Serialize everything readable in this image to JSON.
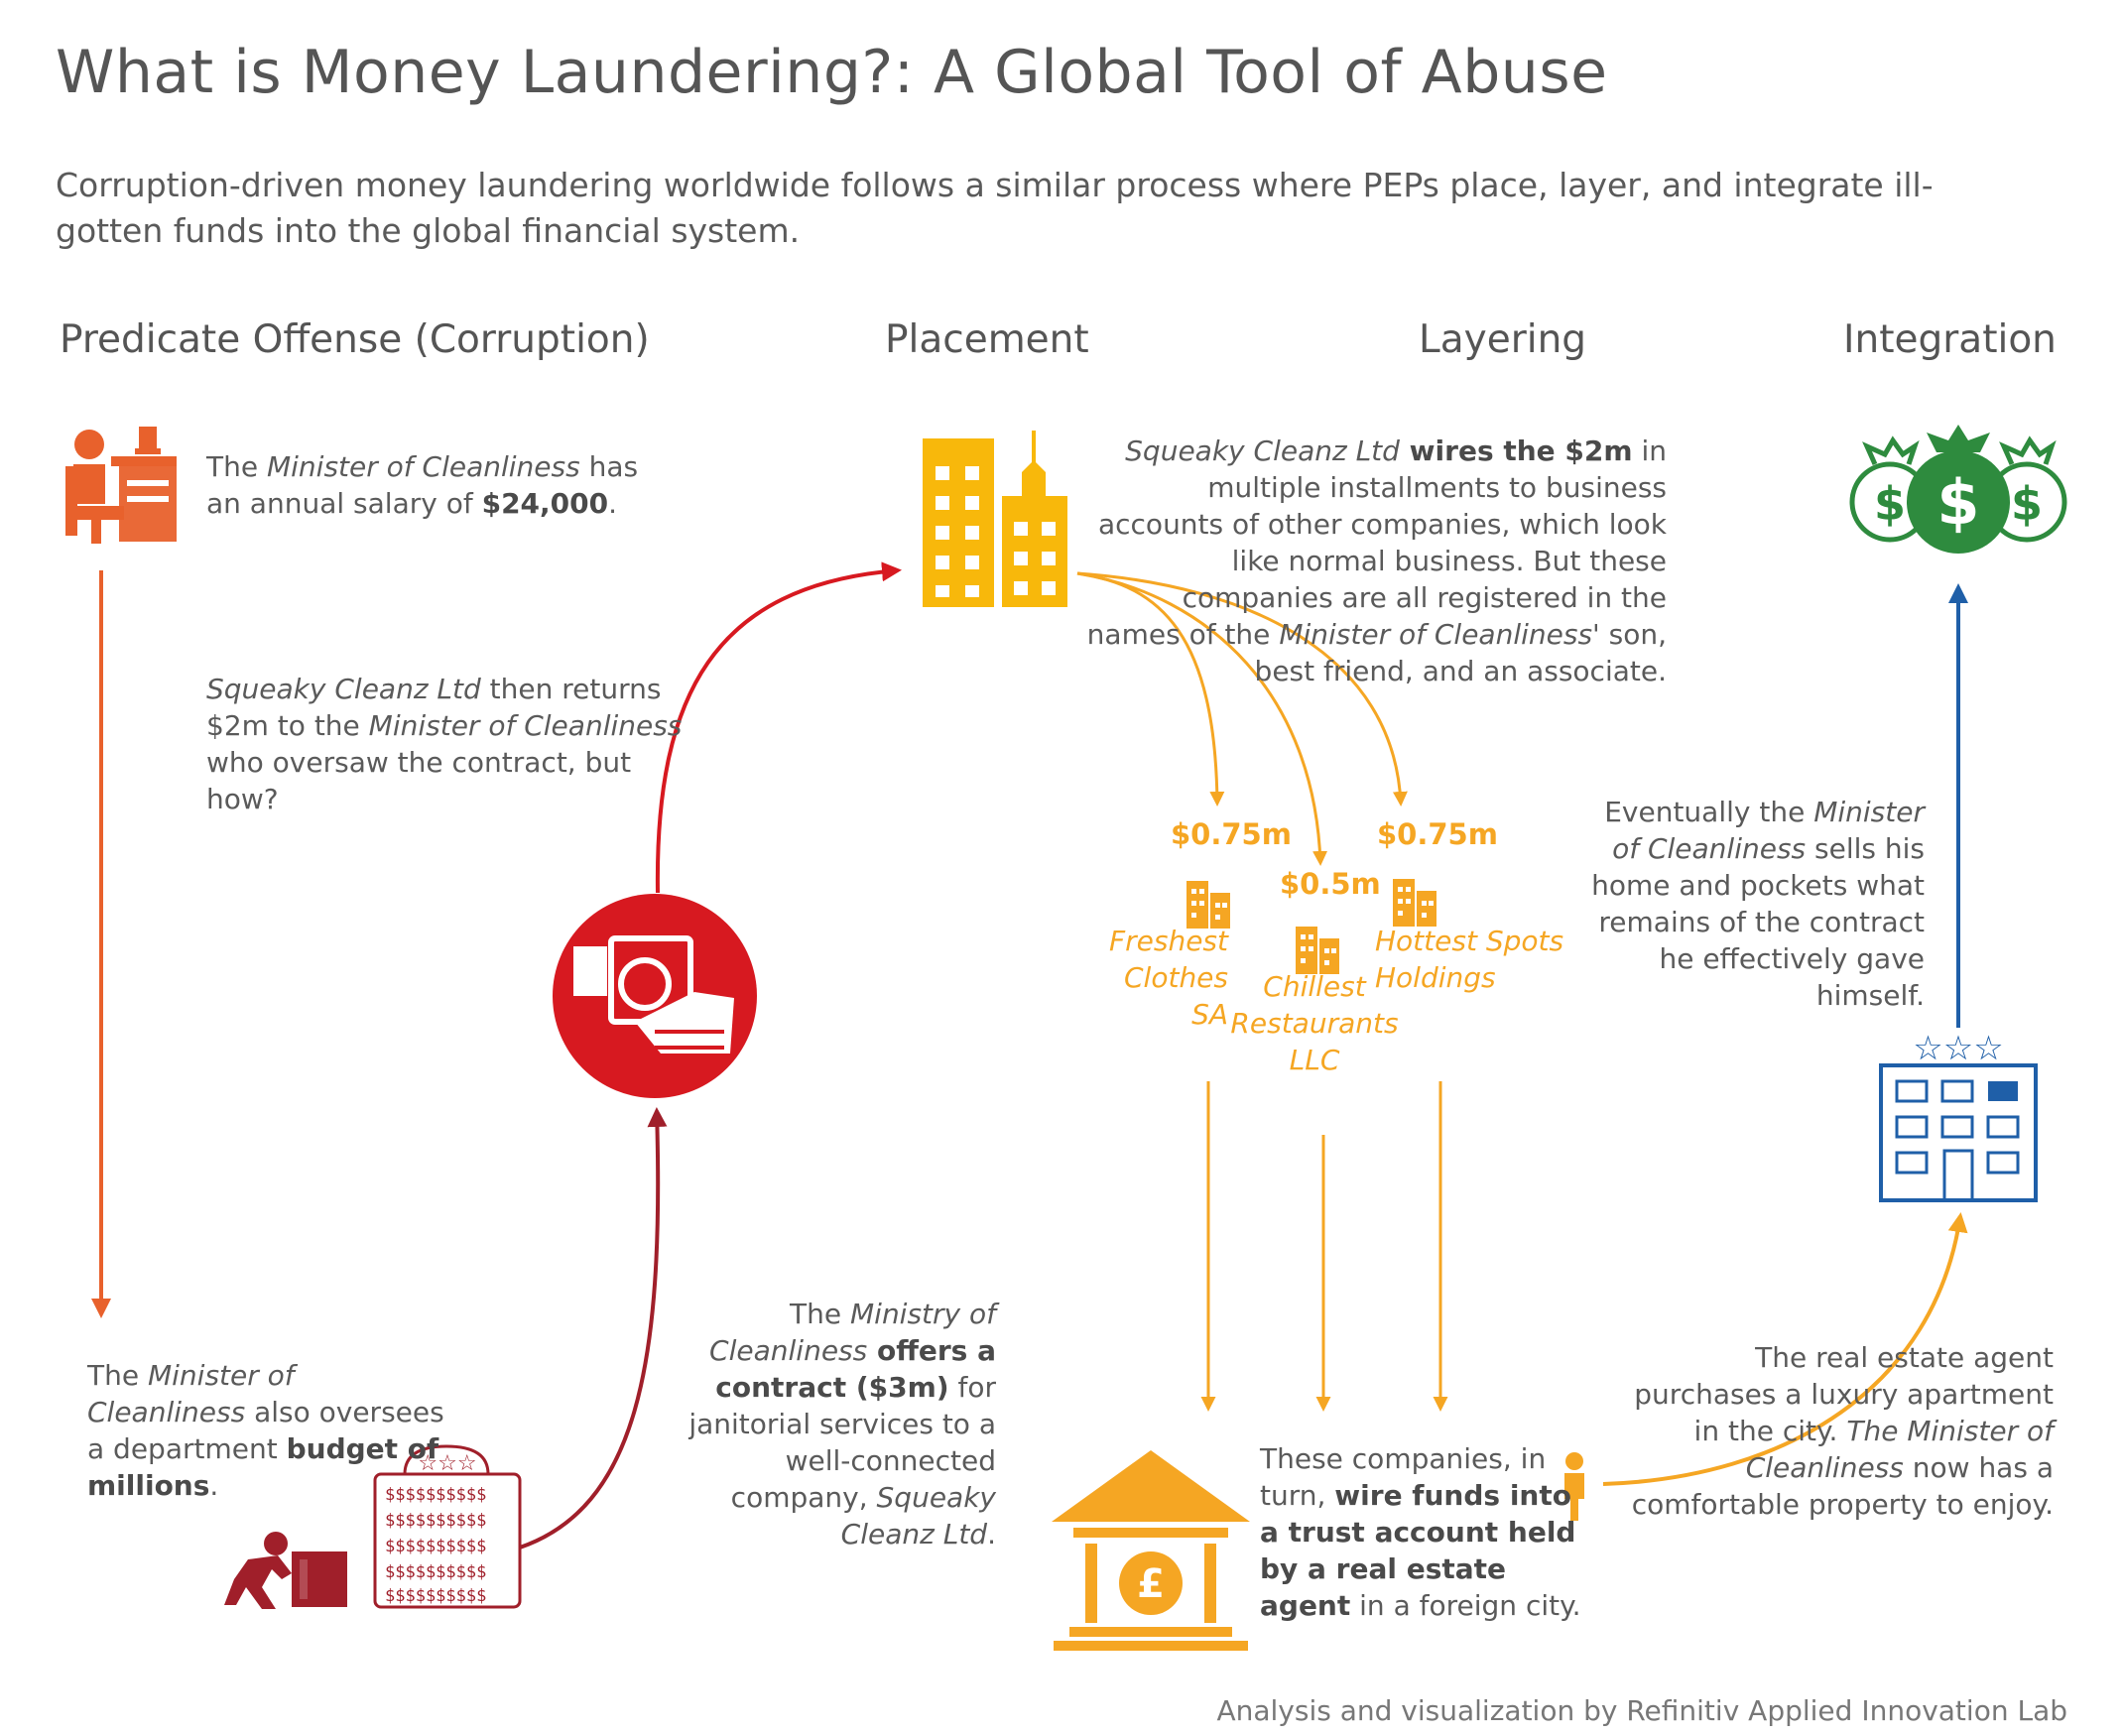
{
  "title": "What is Money Laundering?: A Global Tool of Abuse",
  "subtitle": "Corruption-driven money laundering worldwide follows a similar process where PEPs place, layer, and integrate ill-gotten funds into the global financial system.",
  "stages": {
    "predicate": "Predicate Offense (Corruption)",
    "placement": "Placement",
    "layering": "Layering",
    "integration": "Integration"
  },
  "salary": {
    "a": "The ",
    "b": "Minister of Cleanliness",
    "c": " has an annual salary of ",
    "d": "$24,000",
    "e": "."
  },
  "budget": {
    "a": "The ",
    "b": "Minister of Cleanliness",
    "c": " also oversees a department ",
    "d": "budget of millions",
    "e": "."
  },
  "contract": {
    "a": "The ",
    "b": "Ministry of Cleanliness",
    "c": " offers a contract ($3m)",
    "d": " for janitorial services to a well-connected company, ",
    "e": "Squeaky Cleanz Ltd",
    "f": "."
  },
  "returns": {
    "a": "Squeaky Cleanz Ltd",
    "b": " then returns $2m to the ",
    "c": "Minister of Cleanliness",
    "d": " who oversaw the contract, but how?"
  },
  "wires": {
    "a": "Squeaky Cleanz Ltd",
    "b": " wires the $2m",
    "c": " in multiple installments to business accounts of other companies, which look like normal business. But these companies are all registered in the names of the ",
    "d": "Minister of Cleanliness'",
    "e": " son, best friend, and an associate."
  },
  "companies": [
    {
      "amount": "$0.75m",
      "name": "Freshest Clothes SA"
    },
    {
      "amount": "$0.5m",
      "name": "Chillest Restaurants LLC"
    },
    {
      "amount": "$0.75m",
      "name": "Hottest Spots Holdings"
    }
  ],
  "trust": {
    "a": "These companies, in turn, ",
    "b": "wire funds into a trust account held by a real estate agent",
    "c": " in a foreign city."
  },
  "agent": {
    "a": "The real estate agent purchases a luxury apartment in the city. ",
    "b": "The Minister of Cleanliness",
    "c": " now has a comfortable property to enjoy."
  },
  "sells": {
    "a": "Eventually the ",
    "b": "Minister of Cleanliness",
    "c": " sells his home and pockets what remains of the contract he effectively gave himself."
  },
  "icons": [
    "minister-at-desk-icon",
    "city-buildings-icon",
    "money-bags-icon",
    "bribe-hand-icon",
    "person-pushing-vault-icon",
    "money-stack-icon",
    "bank-pound-icon",
    "person-icon",
    "hotel-icon",
    "small-building-icon"
  ],
  "colors": {
    "orange_red": "#e8612c",
    "red": "#d71920",
    "dark_red": "#a01f2a",
    "amber": "#f5a623",
    "yellow": "#f8b80b",
    "green": "#2e8b3e",
    "blue": "#1f5fa8"
  },
  "footer": "Analysis and visualization by Refinitiv Applied Innovation Lab"
}
